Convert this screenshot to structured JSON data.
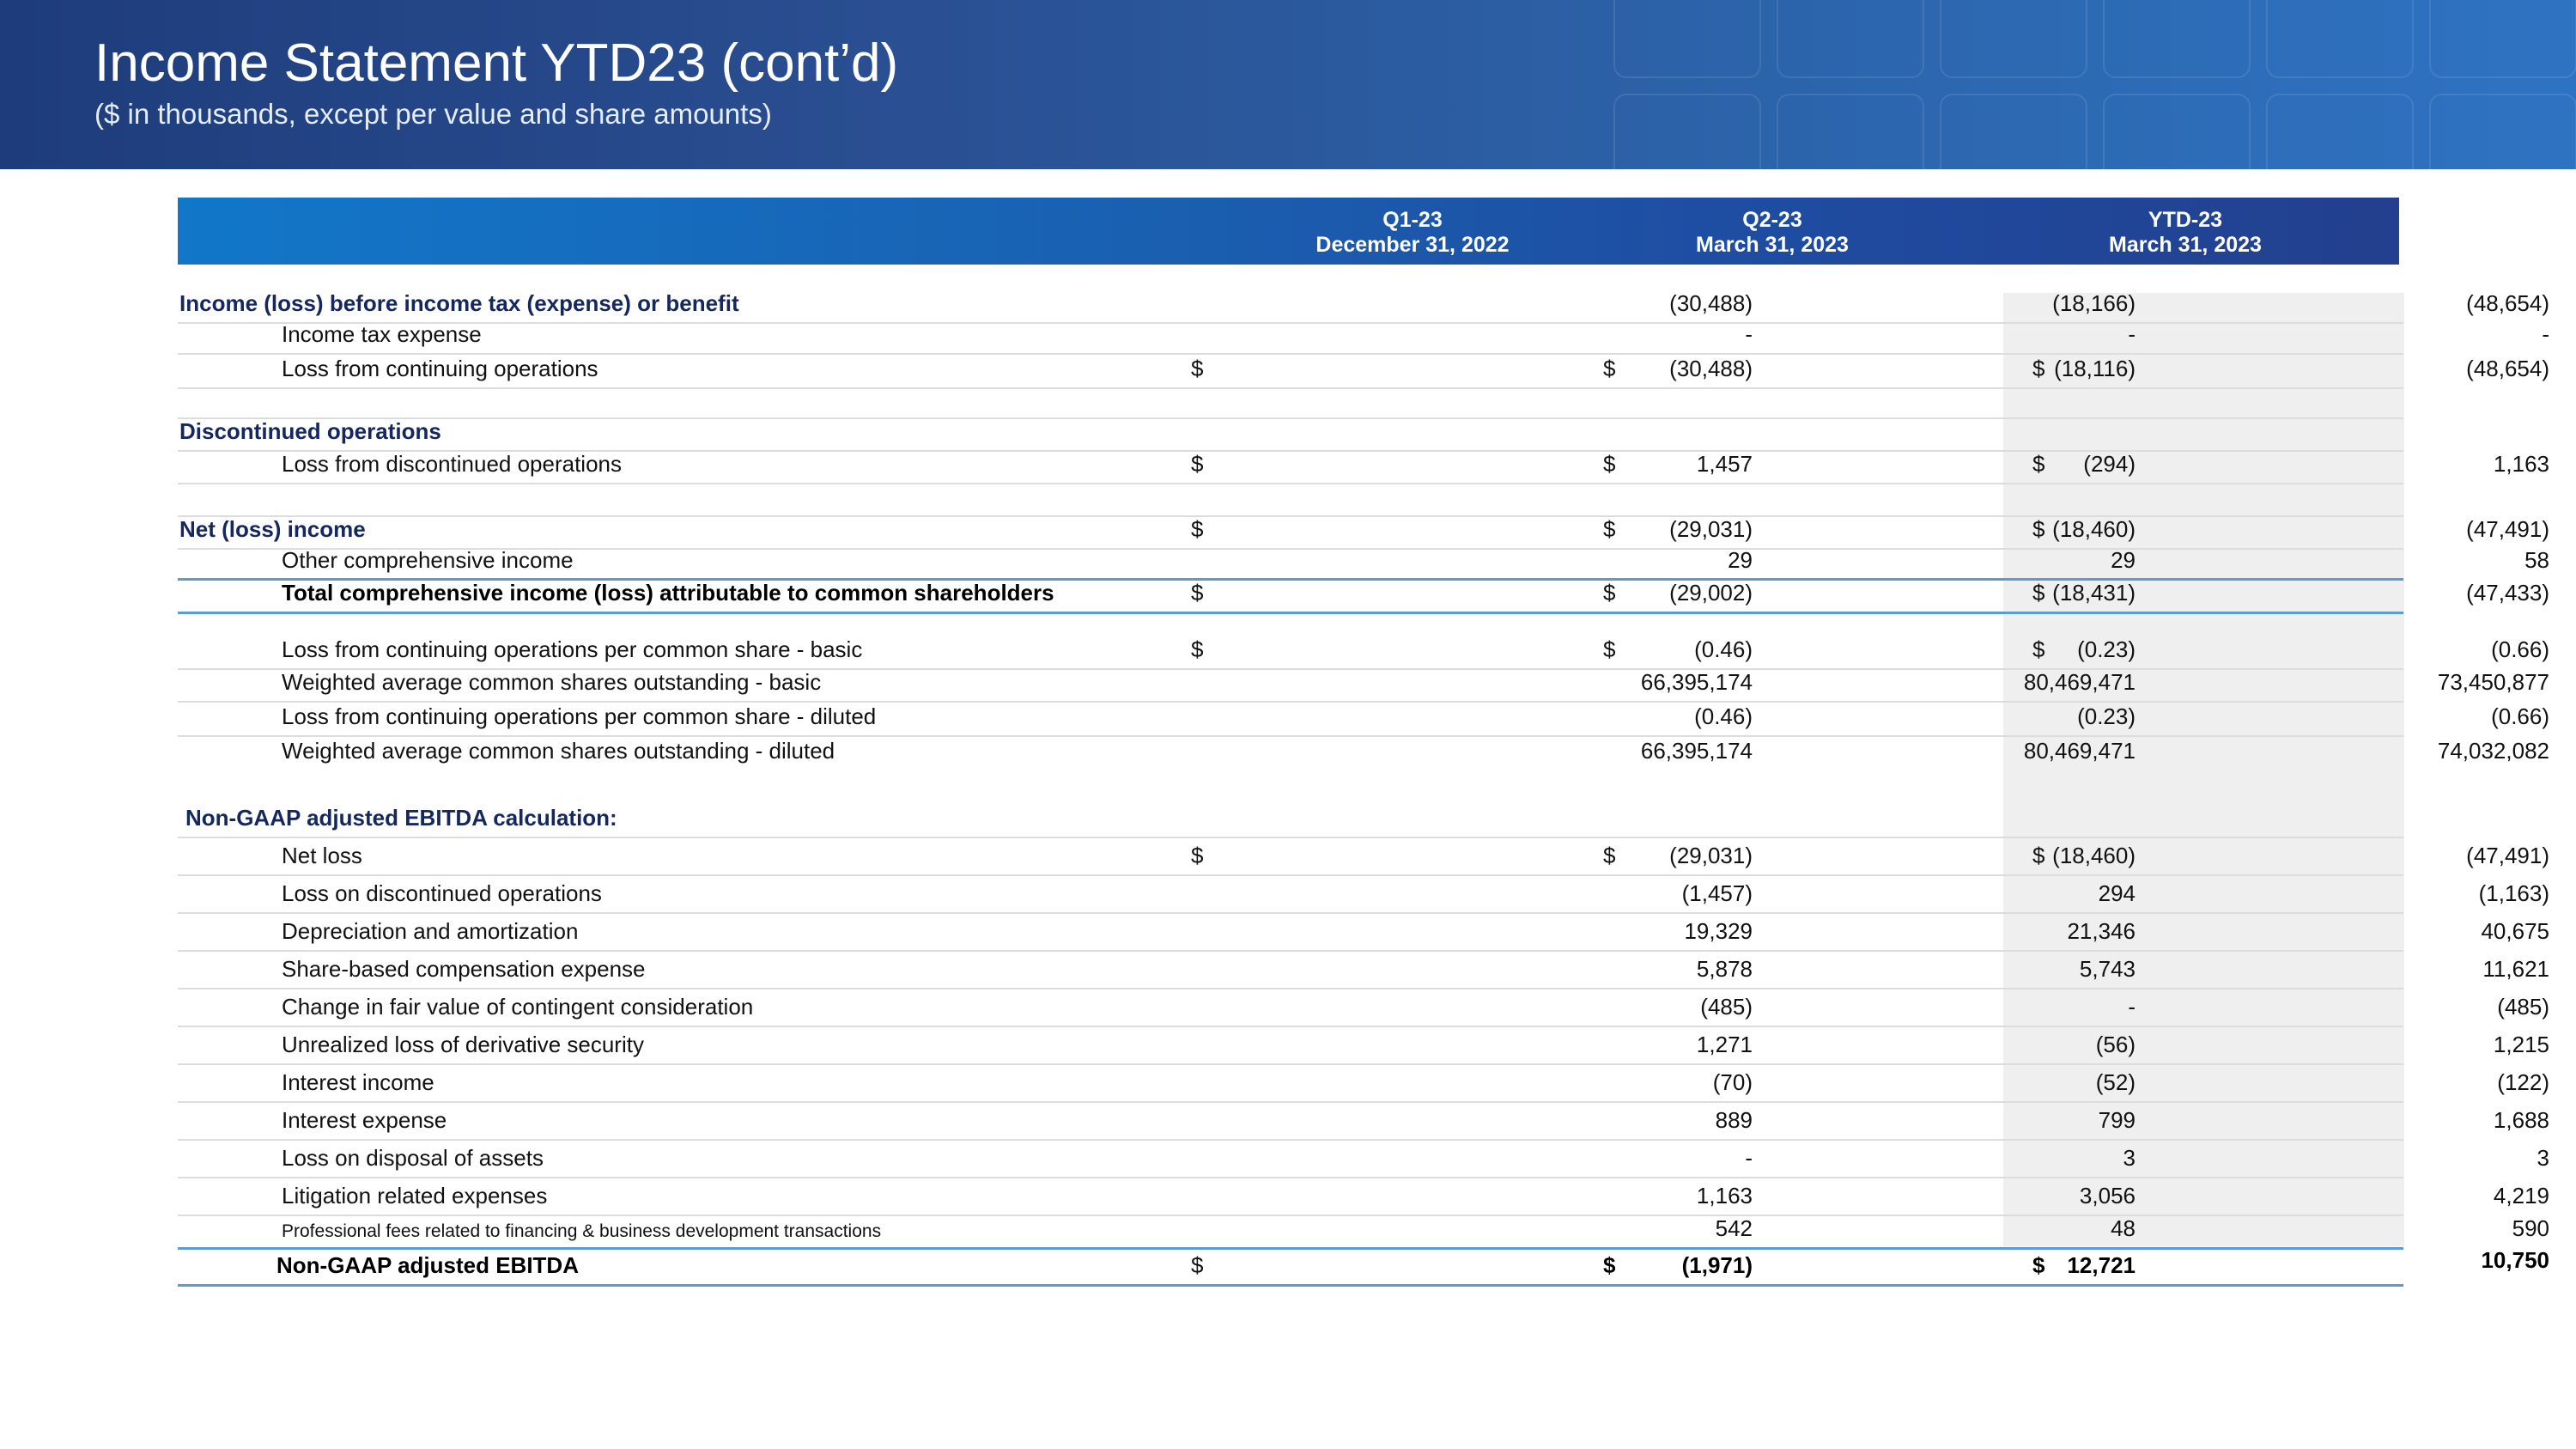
{
  "header": {
    "title": "Income Statement YTD23 (cont’d)",
    "subtitle": "($ in thousands, except per value and share amounts)"
  },
  "colors": {
    "banner": "#1e3c7b",
    "table_header": "#1a5fb0",
    "accent_line": "#5b9bd5",
    "section_text": "#14275f"
  },
  "table": {
    "columns": [
      {
        "period": "Q1-23",
        "date": "December 31, 2022"
      },
      {
        "period": "Q2-23",
        "date": "March 31, 2023"
      },
      {
        "period": "YTD-23",
        "date": "March 31, 2023"
      }
    ],
    "rows": [
      {
        "label": "Income (loss) before income tax (expense) or benefit",
        "style": "section",
        "values": [
          "(30,488)",
          "(18,166)",
          "(48,654)"
        ]
      },
      {
        "label": "Income tax expense",
        "style": "indent",
        "values": [
          "-",
          "-",
          "-"
        ]
      },
      {
        "label": "Loss from continuing operations",
        "style": "indent",
        "dollar": true,
        "values": [
          "(30,488)",
          "(18,116)",
          "(48,654)"
        ]
      },
      {
        "label": "Discontinued operations",
        "style": "section",
        "values": []
      },
      {
        "label": "Loss from discontinued operations",
        "style": "indent",
        "dollar": true,
        "values": [
          "1,457",
          "(294)",
          "1,163"
        ]
      },
      {
        "label": "Net (loss) income",
        "style": "section",
        "dollar": true,
        "values": [
          "(29,031)",
          "(18,460)",
          "(47,491)"
        ]
      },
      {
        "label": "Other comprehensive income",
        "style": "indent",
        "values": [
          "29",
          "29",
          "58"
        ]
      },
      {
        "label": "Total comprehensive income (loss) attributable to common shareholders",
        "style": "indent-bold",
        "dollar": true,
        "values": [
          "(29,002)",
          "(18,431)",
          "(47,433)"
        ]
      },
      {
        "label": "Loss from continuing operations per common share - basic",
        "style": "indent",
        "dollar": true,
        "values": [
          "(0.46)",
          "(0.23)",
          "(0.66)"
        ]
      },
      {
        "label": "Weighted average common shares outstanding - basic",
        "style": "indent",
        "values": [
          "66,395,174",
          "80,469,471",
          "73,450,877"
        ]
      },
      {
        "label": "Loss from continuing operations per common share - diluted",
        "style": "indent",
        "values": [
          "(0.46)",
          "(0.23)",
          "(0.66)"
        ]
      },
      {
        "label": "Weighted average common shares outstanding - diluted",
        "style": "indent",
        "values": [
          "66,395,174",
          "80,469,471",
          "74,032,082"
        ]
      },
      {
        "label": "Non-GAAP adjusted EBITDA calculation:",
        "style": "section",
        "values": []
      },
      {
        "label": "Net loss",
        "style": "indent",
        "dollar": true,
        "values": [
          "(29,031)",
          "(18,460)",
          "(47,491)"
        ]
      },
      {
        "label": "Loss on discontinued operations",
        "style": "indent",
        "values": [
          "(1,457)",
          "294",
          "(1,163)"
        ]
      },
      {
        "label": "Depreciation and amortization",
        "style": "indent",
        "values": [
          "19,329",
          "21,346",
          "40,675"
        ]
      },
      {
        "label": "Share-based compensation expense",
        "style": "indent",
        "values": [
          "5,878",
          "5,743",
          "11,621"
        ]
      },
      {
        "label": "Change in fair value of contingent consideration",
        "style": "indent",
        "values": [
          "(485)",
          "-",
          "(485)"
        ]
      },
      {
        "label": "Unrealized loss of derivative security",
        "style": "indent",
        "values": [
          "1,271",
          "(56)",
          "1,215"
        ]
      },
      {
        "label": "Interest income",
        "style": "indent",
        "values": [
          "(70)",
          "(52)",
          "(122)"
        ]
      },
      {
        "label": "Interest expense",
        "style": "indent",
        "values": [
          "889",
          "799",
          "1,688"
        ]
      },
      {
        "label": "Loss on disposal of assets",
        "style": "indent",
        "values": [
          "-",
          "3",
          "3"
        ]
      },
      {
        "label": "Litigation related expenses",
        "style": "indent",
        "values": [
          "1,163",
          "3,056",
          "4,219"
        ]
      },
      {
        "label": "Professional fees related to financing & business development transactions",
        "style": "indent-small",
        "values": [
          "542",
          "48",
          "590"
        ]
      },
      {
        "label": "Non-GAAP adjusted EBITDA",
        "style": "indent-bold",
        "dollar": true,
        "values": [
          "(1,971)",
          "12,721",
          "10,750"
        ]
      }
    ],
    "currency_symbol": "$"
  }
}
